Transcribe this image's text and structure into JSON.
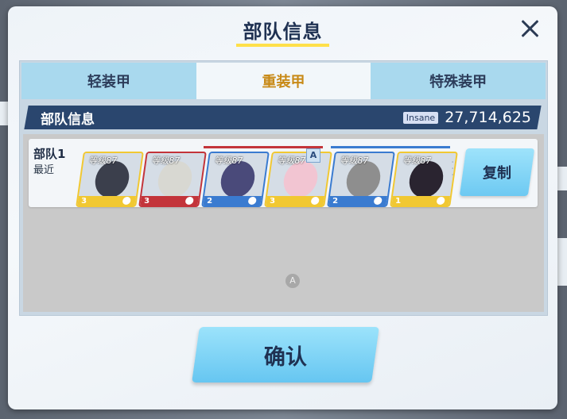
{
  "dialog": {
    "title": "部队信息",
    "confirm_label": "确认"
  },
  "tabs": [
    {
      "label": "轻装甲",
      "active": false
    },
    {
      "label": "重装甲",
      "active": true
    },
    {
      "label": "特殊装甲",
      "active": false
    }
  ],
  "header": {
    "title": "部队信息",
    "difficulty_badge": "Insane",
    "score": "27,714,625"
  },
  "team": {
    "name": "部队1",
    "sub": "最近",
    "copy_label": "复制",
    "members": [
      {
        "level": "等级87",
        "slot": "3",
        "border": "gold",
        "accent": "#f1c832"
      },
      {
        "level": "等级87",
        "slot": "3",
        "border": "red",
        "accent": "#c3343a"
      },
      {
        "level": "等级87",
        "slot": "2",
        "border": "blue",
        "accent": "#3a7bd0"
      },
      {
        "level": "等级87",
        "slot": "3",
        "border": "gold",
        "accent": "#f1c832"
      },
      {
        "level": "等级87",
        "slot": "2",
        "border": "blue",
        "accent": "#3a7bd0"
      },
      {
        "level": "等级87",
        "slot": "1",
        "border": "gold",
        "accent": "#f1c832"
      }
    ],
    "special_badge": "A"
  },
  "list_marker": "A",
  "colors": {
    "title": "#1f3152",
    "active_tab_text": "#c88a17",
    "header_bar": "#2a466e",
    "button": "#6dc9f2",
    "title_underline": "#ffe04a"
  }
}
